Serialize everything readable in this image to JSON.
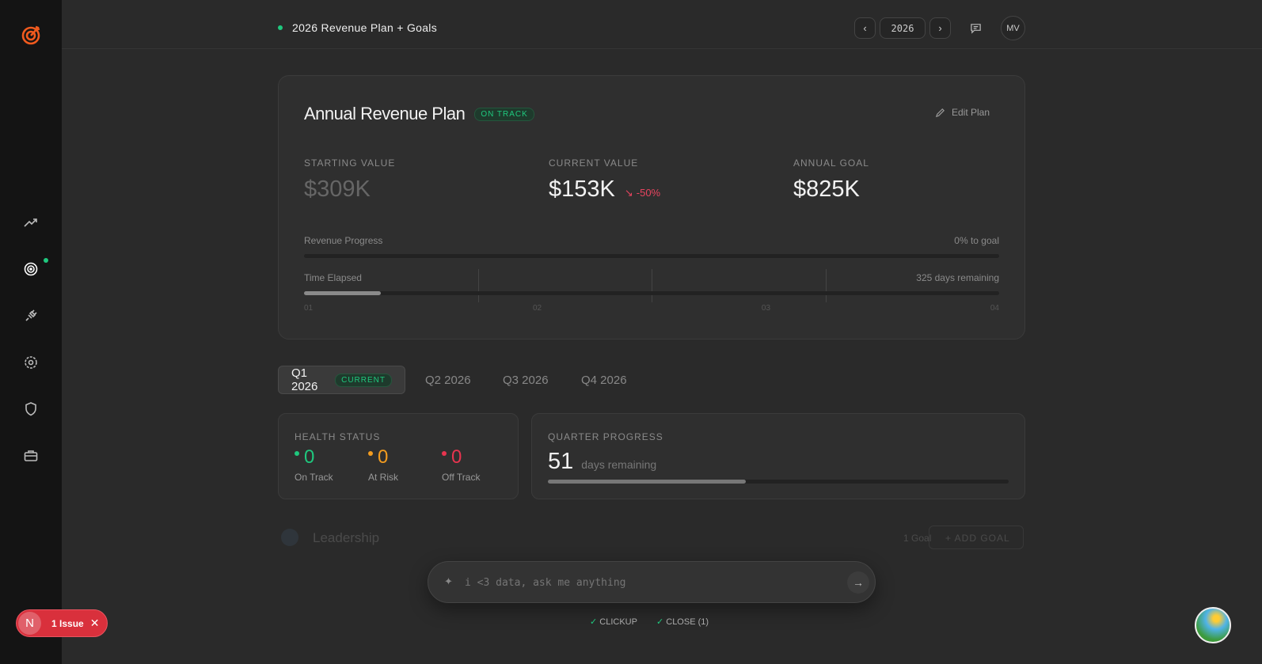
{
  "header": {
    "title": "2026 Revenue Plan + Goals",
    "year": "2026",
    "avatar": "MV"
  },
  "plan": {
    "title": "Annual Revenue Plan",
    "status": "ON TRACK",
    "edit_label": "Edit Plan",
    "starting_label": "STARTING VALUE",
    "starting_value": "$309K",
    "current_label": "CURRENT VALUE",
    "current_value": "$153K",
    "current_change": "-50%",
    "goal_label": "ANNUAL GOAL",
    "goal_value": "$825K",
    "revenue_progress_label": "Revenue Progress",
    "revenue_progress_text": "0% to goal",
    "revenue_progress_pct": 0,
    "time_label": "Time Elapsed",
    "time_text": "325 days remaining",
    "time_pct": 11,
    "quarters": [
      "01",
      "02",
      "03",
      "04"
    ]
  },
  "tabs": [
    {
      "label": "Q1 2026",
      "badge": "CURRENT"
    },
    {
      "label": "Q2 2026"
    },
    {
      "label": "Q3 2026"
    },
    {
      "label": "Q4 2026"
    }
  ],
  "health": {
    "title": "HEALTH STATUS",
    "items": [
      {
        "count": "0",
        "label": "On Track",
        "color": "#1fc87e"
      },
      {
        "count": "0",
        "label": "At Risk",
        "color": "#f39c1f"
      },
      {
        "count": "0",
        "label": "Off Track",
        "color": "#e8344f"
      }
    ]
  },
  "quarter": {
    "title": "QUARTER PROGRESS",
    "days": "51",
    "days_label": "days remaining",
    "pct": 43
  },
  "group": {
    "name": "Leadership",
    "count": "1 Goal",
    "add": "+ ADD GOAL"
  },
  "chat": {
    "placeholder": "i <3 data, ask me anything"
  },
  "footer": {
    "clickup": "CLICKUP",
    "close": "CLOSE (1)"
  },
  "issue": {
    "letter": "N",
    "label": "1 Issue"
  }
}
